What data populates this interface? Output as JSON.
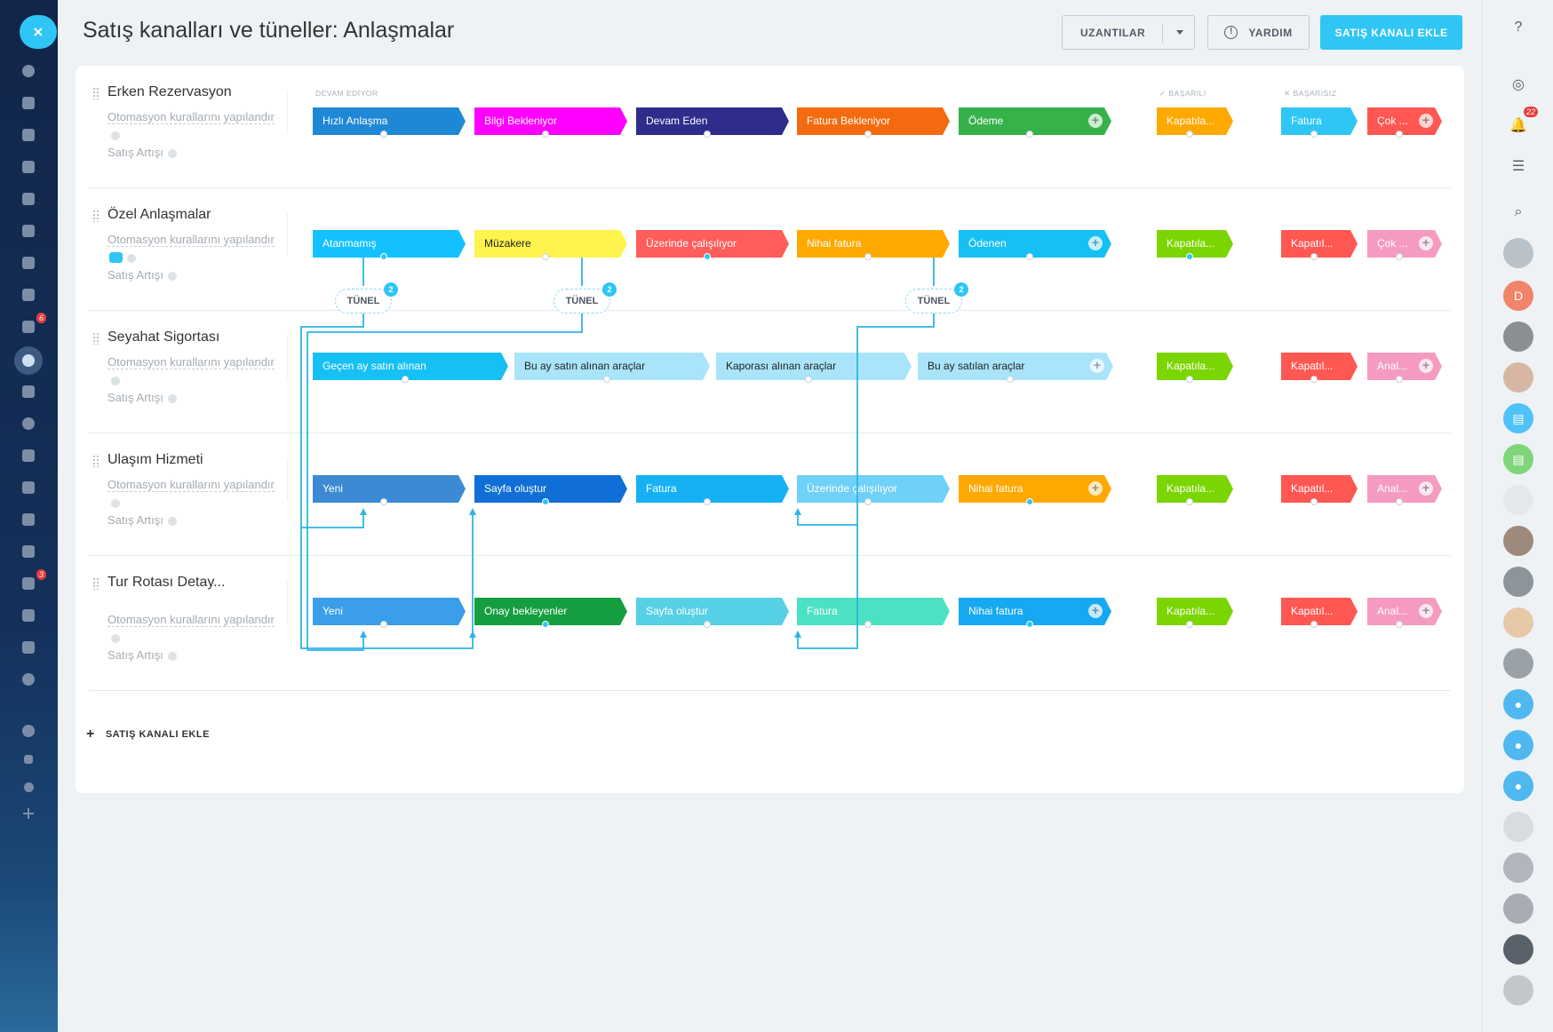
{
  "header": {
    "title": "Satış kanalları ve tüneller: Anlaşmalar",
    "extensions_label": "UZANTILAR",
    "help_label": "YARDIM",
    "add_pipeline_label": "SATIŞ KANALI EKLE"
  },
  "columns": {
    "in_progress": "DEVAM EDİYOR",
    "success": "BAŞARILI",
    "failure": "BAŞARISIZ"
  },
  "common": {
    "automation_label": "Otomasyon kurallarını yapılandır",
    "sales_label": "Satış Artışı",
    "tunnel_label": "TÜNEL"
  },
  "sidebar_badges": {
    "tasks": "6",
    "calendar": "3"
  },
  "right_badges": {
    "notifications": "22"
  },
  "right_avatar_letter": "D",
  "footer": {
    "add_pipeline_label": "SATIŞ KANALI EKLE"
  },
  "pipelines": [
    {
      "name": "Erken Rezervasyon",
      "stages": [
        {
          "label": "Hızlı Anlaşma",
          "color": "#1e88d6"
        },
        {
          "label": "Bilgi Bekleniyor",
          "color": "#ff00ff"
        },
        {
          "label": "Devam Eden",
          "color": "#2e2d8c"
        },
        {
          "label": "Fatura Bekleniyor",
          "color": "#f46b0f"
        },
        {
          "label": "Ödeme",
          "color": "#36b24a"
        }
      ],
      "success": {
        "label": "Kapatıla...",
        "color": "#ffa900"
      },
      "failure": [
        {
          "label": "Fatura",
          "color": "#2fc6f6"
        },
        {
          "label": "Çok ...",
          "color": "#ff5752"
        }
      ]
    },
    {
      "name": "Özel Anlaşmalar",
      "stages": [
        {
          "label": "Atanmamış",
          "color": "#14c1ff"
        },
        {
          "label": "Müzakere",
          "color": "#fff34d"
        },
        {
          "label": "Üzerinde çalışılıyor",
          "color": "#ff5d5b"
        },
        {
          "label": "Nihai fatura",
          "color": "#ffa900"
        },
        {
          "label": "Ödenen",
          "color": "#16c0f5"
        }
      ],
      "success": {
        "label": "Kapatıla...",
        "color": "#7bd500"
      },
      "failure": [
        {
          "label": "Kapatıl...",
          "color": "#ff5752"
        },
        {
          "label": "Çok ...",
          "color": "#f59bc2"
        }
      ]
    },
    {
      "name": "Seyahat Sigortası",
      "stages": [
        {
          "label": "Geçen ay satın alınan",
          "color": "#16c0f5"
        },
        {
          "label": "Bu ay satın alınan araçlar",
          "color": "#a9e4fb"
        },
        {
          "label": "Kaporası alınan araçlar",
          "color": "#a9e4fb"
        },
        {
          "label": "Bu ay satılan araçlar",
          "color": "#a9e4fb"
        }
      ],
      "success": {
        "label": "Kapatıla...",
        "color": "#7bd500"
      },
      "failure": [
        {
          "label": "Kapatıl...",
          "color": "#ff5752"
        },
        {
          "label": "Anal...",
          "color": "#f59bc2"
        }
      ]
    },
    {
      "name": "Ulaşım Hizmeti",
      "stages": [
        {
          "label": "Yeni",
          "color": "#3c8ad3"
        },
        {
          "label": "Sayfa oluştur",
          "color": "#0f6fd6"
        },
        {
          "label": "Fatura",
          "color": "#16b1f5"
        },
        {
          "label": "Üzerinde çalışılıyor",
          "color": "#6fd0f8"
        },
        {
          "label": "Nihai fatura",
          "color": "#ffa900"
        }
      ],
      "success": {
        "label": "Kapatıla...",
        "color": "#7bd500"
      },
      "failure": [
        {
          "label": "Kapatıl...",
          "color": "#ff5752"
        },
        {
          "label": "Anal...",
          "color": "#f59bc2"
        }
      ]
    },
    {
      "name": "Tur Rotası Detay...",
      "stages": [
        {
          "label": "Yeni",
          "color": "#3a9eea"
        },
        {
          "label": "Onay bekleyenler",
          "color": "#149e3f"
        },
        {
          "label": "Sayfa oluştur",
          "color": "#55d0e4"
        },
        {
          "label": "Fatura",
          "color": "#4be2c3"
        },
        {
          "label": "Nihai fatura",
          "color": "#16a8f0"
        }
      ],
      "success": {
        "label": "Kapatıla...",
        "color": "#7bd500"
      },
      "failure": [
        {
          "label": "Kapatıl...",
          "color": "#ff5752"
        },
        {
          "label": "Anal...",
          "color": "#f59bc2"
        }
      ]
    }
  ]
}
